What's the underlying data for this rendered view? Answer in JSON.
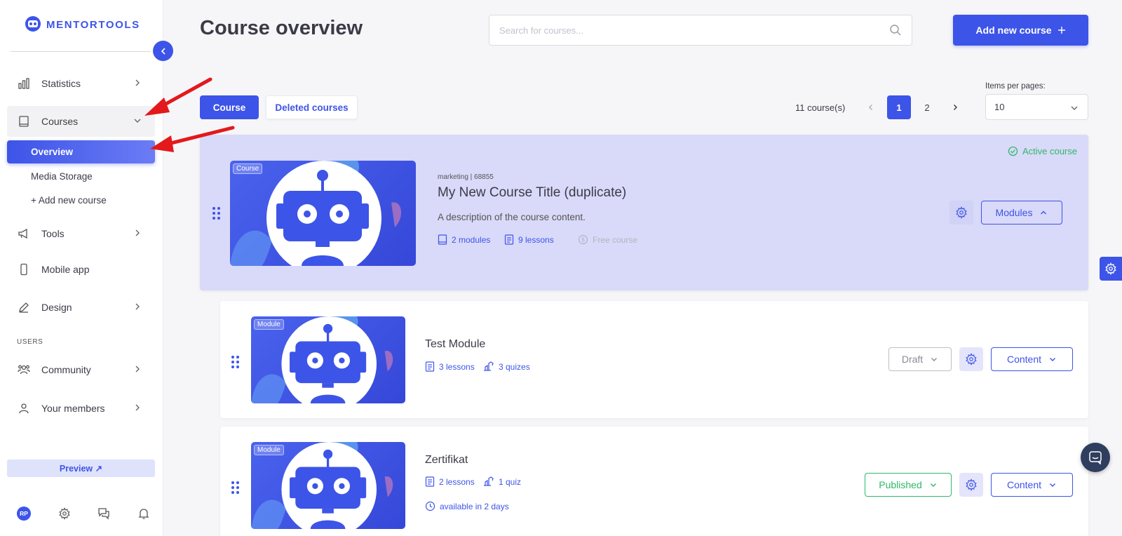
{
  "app": {
    "logo_text": "MENTORTOOLS"
  },
  "sidebar": {
    "items": [
      {
        "label": "Statistics",
        "icon": "bar-chart-icon"
      },
      {
        "label": "Courses",
        "icon": "book-icon"
      },
      {
        "label": "Tools",
        "icon": "megaphone-icon"
      },
      {
        "label": "Mobile app",
        "icon": "phone-icon"
      },
      {
        "label": "Design",
        "icon": "pencil-icon"
      },
      {
        "label": "Community",
        "icon": "group-icon"
      },
      {
        "label": "Your members",
        "icon": "user-icon"
      }
    ],
    "courses_sub": [
      "Overview",
      "Media Storage",
      "+ Add new course"
    ],
    "section_users": "USERS",
    "preview_label": "Preview ↗",
    "avatar_initials": "RP"
  },
  "header": {
    "title": "Course overview",
    "search_placeholder": "Search for courses...",
    "add_button": "Add new course"
  },
  "tabs": {
    "course": "Course",
    "deleted": "Deleted courses"
  },
  "pagination": {
    "count_text": "11 course(s)",
    "pages": [
      "1",
      "2"
    ],
    "current": "1",
    "items_per_page_label": "Items per pages:",
    "items_per_page_value": "10"
  },
  "course": {
    "thumb_tag": "Course",
    "meta": "marketing | 68855",
    "title": "My New Course Title (duplicate)",
    "description": "A description of the course content.",
    "modules": "2 modules",
    "lessons": "9 lessons",
    "price": "Free course",
    "status": "Active course",
    "modules_button": "Modules"
  },
  "modules": [
    {
      "thumb_tag": "Module",
      "title": "Test Module",
      "lessons": "3 lessons",
      "quizzes": "3 quizes",
      "status": "Draft",
      "content_button": "Content"
    },
    {
      "thumb_tag": "Module",
      "title": "Zertifikat",
      "lessons": "2 lessons",
      "quizzes": "1 quiz",
      "availability": "available in 2 days",
      "status": "Published",
      "content_button": "Content"
    }
  ],
  "colors": {
    "primary": "#3d54e8",
    "course_card_bg": "#d9d9f9",
    "success": "#2fb86a",
    "annotation_arrow": "#e3191b"
  }
}
